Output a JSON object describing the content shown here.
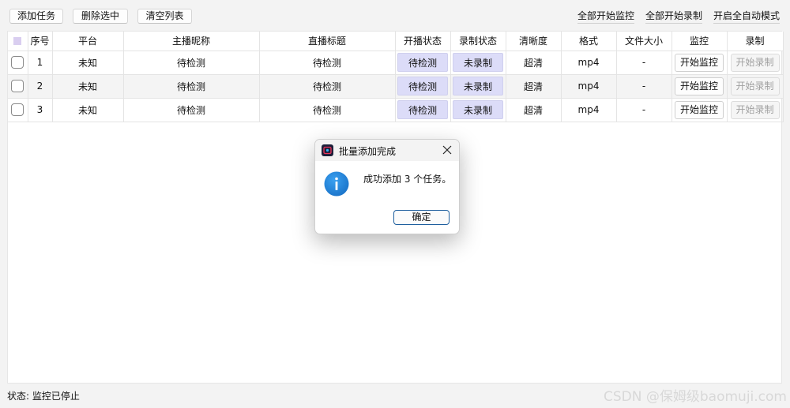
{
  "toolbar": {
    "add_task": "添加任务",
    "delete_selected": "删除选中",
    "clear_list": "清空列表",
    "start_all_monitor": "全部开始监控",
    "start_all_record": "全部开始录制",
    "enable_auto_mode": "开启全自动模式"
  },
  "table": {
    "headers": [
      "序号",
      "平台",
      "主播昵称",
      "直播标题",
      "开播状态",
      "录制状态",
      "清晰度",
      "格式",
      "文件大小",
      "监控",
      "录制"
    ],
    "rows": [
      {
        "index": "1",
        "platform": "未知",
        "nickname": "待检测",
        "title": "待检测",
        "live_status": "待检测",
        "record_status": "未录制",
        "quality": "超清",
        "format": "mp4",
        "size": "-",
        "monitor_btn": "开始监控",
        "record_btn": "开始录制"
      },
      {
        "index": "2",
        "platform": "未知",
        "nickname": "待检测",
        "title": "待检测",
        "live_status": "待检测",
        "record_status": "未录制",
        "quality": "超清",
        "format": "mp4",
        "size": "-",
        "monitor_btn": "开始监控",
        "record_btn": "开始录制"
      },
      {
        "index": "3",
        "platform": "未知",
        "nickname": "待检测",
        "title": "待检测",
        "live_status": "待检测",
        "record_status": "未录制",
        "quality": "超清",
        "format": "mp4",
        "size": "-",
        "monitor_btn": "开始监控",
        "record_btn": "开始录制"
      }
    ]
  },
  "dialog": {
    "title": "批量添加完成",
    "message": "成功添加 3 个任务。",
    "ok": "确定",
    "icon": "info-icon"
  },
  "status_bar": "状态: 监控已停止",
  "watermark": "CSDN @保姆级baomuji.com",
  "colors": {
    "pill": "#dcdcf8",
    "dialog_button_border": "#1f5f9e",
    "info_icon": "#1a73c9"
  }
}
